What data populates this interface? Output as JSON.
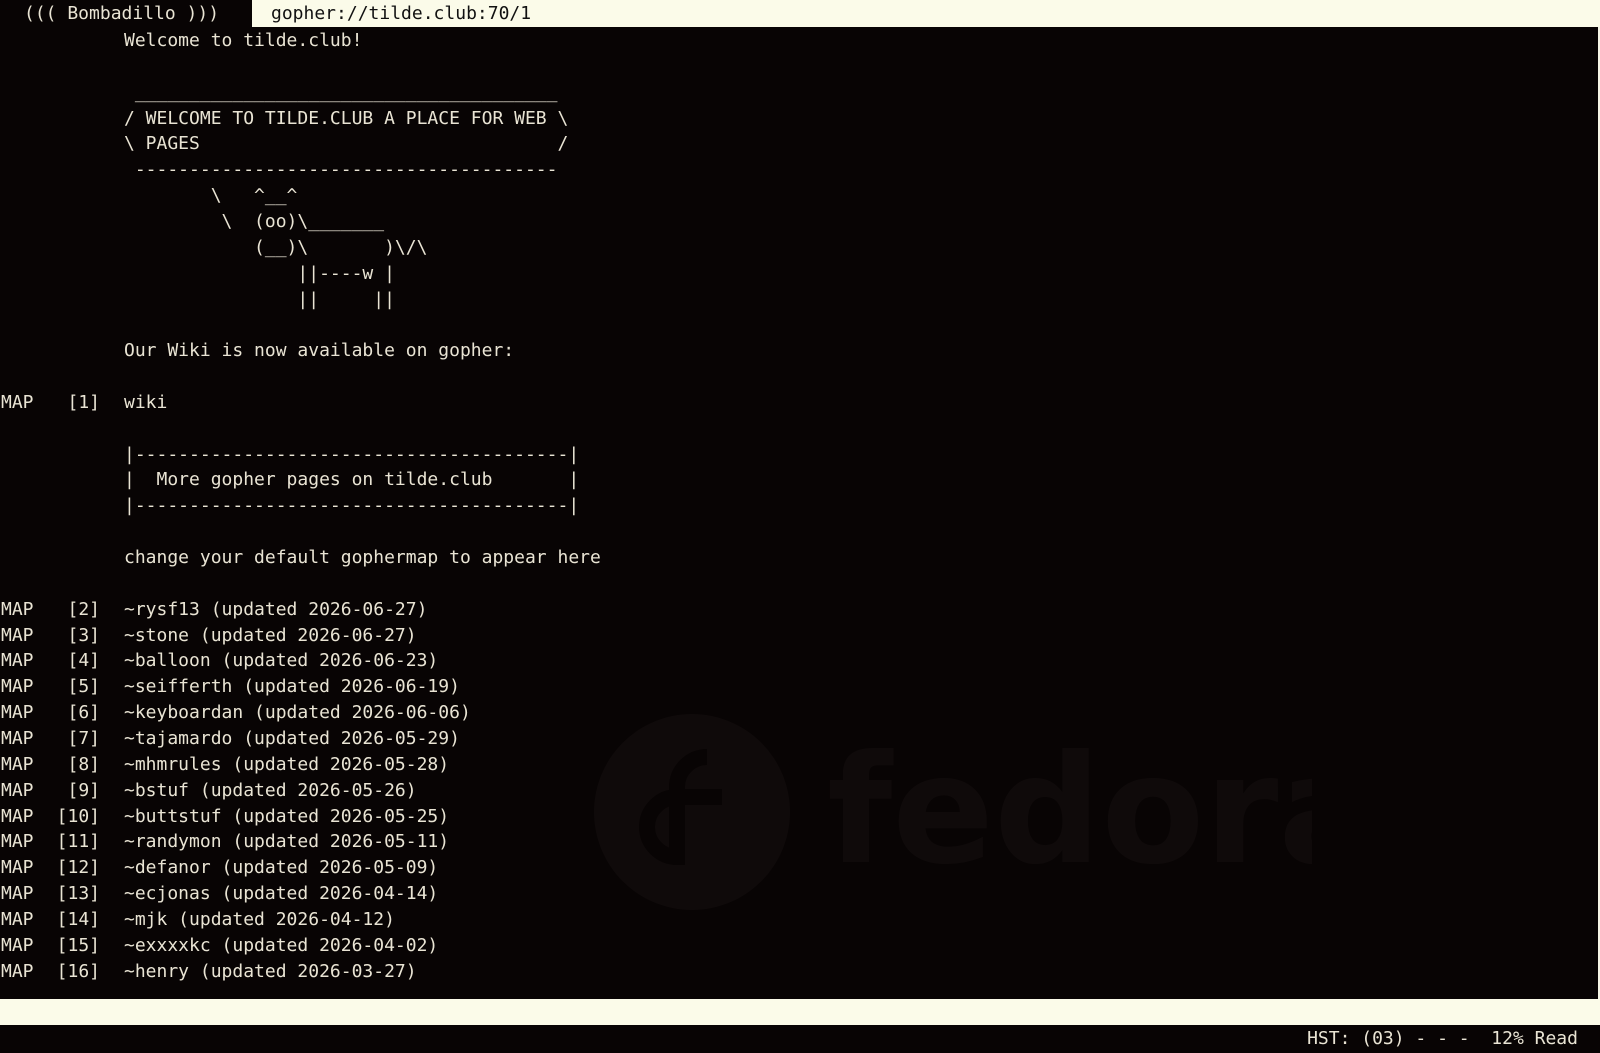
{
  "app": {
    "title": "((( Bombadillo )))"
  },
  "address": {
    "url": "gopher://tilde.club:70/1"
  },
  "watermark": {
    "brand": "fedora"
  },
  "lines": [
    {
      "type": "",
      "idx": "",
      "text": "Welcome to tilde.club!"
    },
    {
      "type": "",
      "idx": "",
      "text": ""
    },
    {
      "type": "",
      "idx": "",
      "text": " _______________________________________"
    },
    {
      "type": "",
      "idx": "",
      "text": "/ WELCOME TO TILDE.CLUB A PLACE FOR WEB \\"
    },
    {
      "type": "",
      "idx": "",
      "text": "\\ PAGES                                 /"
    },
    {
      "type": "",
      "idx": "",
      "text": " ---------------------------------------"
    },
    {
      "type": "",
      "idx": "",
      "text": "        \\   ^__^"
    },
    {
      "type": "",
      "idx": "",
      "text": "         \\  (oo)\\_______"
    },
    {
      "type": "",
      "idx": "",
      "text": "            (__)\\       )\\/\\"
    },
    {
      "type": "",
      "idx": "",
      "text": "                ||----w |"
    },
    {
      "type": "",
      "idx": "",
      "text": "                ||     ||"
    },
    {
      "type": "",
      "idx": "",
      "text": ""
    },
    {
      "type": "",
      "idx": "",
      "text": "Our Wiki is now available on gopher:"
    },
    {
      "type": "",
      "idx": "",
      "text": ""
    },
    {
      "type": "MAP",
      "idx": "[1]",
      "text": "wiki"
    },
    {
      "type": "",
      "idx": "",
      "text": ""
    },
    {
      "type": "",
      "idx": "",
      "text": "|----------------------------------------|"
    },
    {
      "type": "",
      "idx": "",
      "text": "|  More gopher pages on tilde.club       |"
    },
    {
      "type": "",
      "idx": "",
      "text": "|----------------------------------------|"
    },
    {
      "type": "",
      "idx": "",
      "text": ""
    },
    {
      "type": "",
      "idx": "",
      "text": "change your default gophermap to appear here"
    },
    {
      "type": "",
      "idx": "",
      "text": ""
    },
    {
      "type": "MAP",
      "idx": "[2]",
      "text": "~rysf13 (updated 2026-06-27)"
    },
    {
      "type": "MAP",
      "idx": "[3]",
      "text": "~stone (updated 2026-06-27)"
    },
    {
      "type": "MAP",
      "idx": "[4]",
      "text": "~balloon (updated 2026-06-23)"
    },
    {
      "type": "MAP",
      "idx": "[5]",
      "text": "~seifferth (updated 2026-06-19)"
    },
    {
      "type": "MAP",
      "idx": "[6]",
      "text": "~keyboardan (updated 2026-06-06)"
    },
    {
      "type": "MAP",
      "idx": "[7]",
      "text": "~tajamardo (updated 2026-05-29)"
    },
    {
      "type": "MAP",
      "idx": "[8]",
      "text": "~mhmrules (updated 2026-05-28)"
    },
    {
      "type": "MAP",
      "idx": "[9]",
      "text": "~bstuf (updated 2026-05-26)"
    },
    {
      "type": "MAP",
      "idx": "[10]",
      "text": "~buttstuf (updated 2026-05-25)"
    },
    {
      "type": "MAP",
      "idx": "[11]",
      "text": "~randymon (updated 2026-05-11)"
    },
    {
      "type": "MAP",
      "idx": "[12]",
      "text": "~defanor (updated 2026-05-09)"
    },
    {
      "type": "MAP",
      "idx": "[13]",
      "text": "~ecjonas (updated 2026-04-14)"
    },
    {
      "type": "MAP",
      "idx": "[14]",
      "text": "~mjk (updated 2026-04-12)"
    },
    {
      "type": "MAP",
      "idx": "[15]",
      "text": "~exxxxkc (updated 2026-04-02)"
    },
    {
      "type": "MAP",
      "idx": "[16]",
      "text": "~henry (updated 2026-03-27)"
    }
  ],
  "status": {
    "text": "HST: (03) - - -  12% Read"
  },
  "colors": {
    "background": "#080404",
    "text": "#e9e4d4",
    "bar": "#fbfbe9"
  }
}
